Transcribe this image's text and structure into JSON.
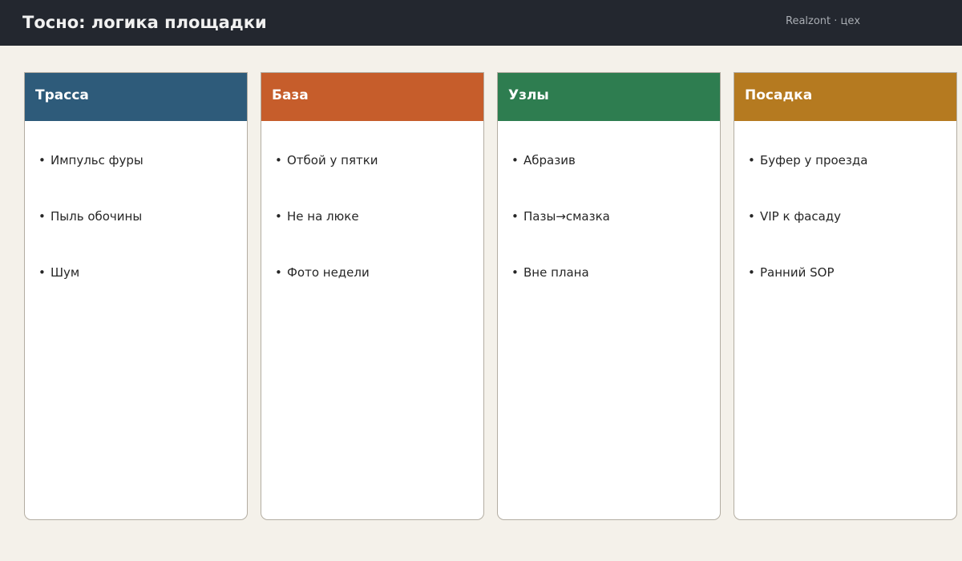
{
  "header": {
    "title": "Тосно: логика площадки",
    "caption": "Realzont · цех"
  },
  "columns": [
    {
      "title": "Трасса",
      "color": "#2e5b7a",
      "items": [
        "Импульс фуры",
        "Пыль обочины",
        "Шум"
      ]
    },
    {
      "title": "База",
      "color": "#c65d2b",
      "items": [
        "Отбой у пятки",
        "Не на люке",
        "Фото недели"
      ]
    },
    {
      "title": "Узлы",
      "color": "#2e7d50",
      "items": [
        "Абразив",
        "Пазы→смазка",
        "Вне плана"
      ]
    },
    {
      "title": "Посадка",
      "color": "#b57a20",
      "items": [
        "Буфер у проезда",
        "VIP к фасаду",
        "Ранний SOP"
      ]
    }
  ],
  "bullet_glyph": "•"
}
